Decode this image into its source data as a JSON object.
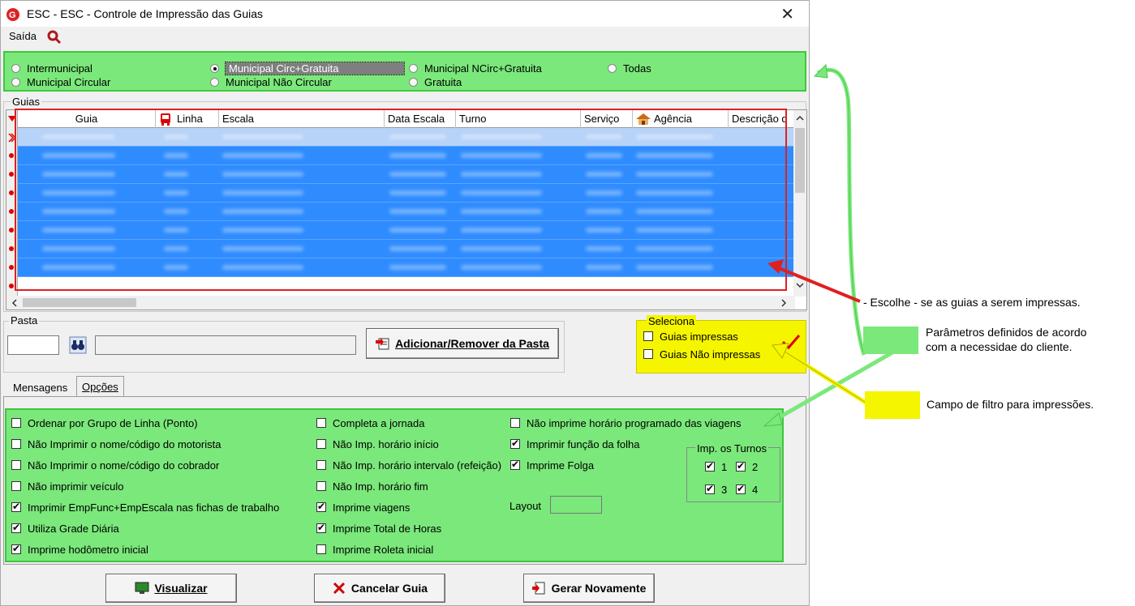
{
  "window": {
    "title": "ESC -  ESC - Controle de Impressão das Guias",
    "close_glyph": "✕"
  },
  "menu": {
    "saida": "Saída"
  },
  "tipo_guia": {
    "options": [
      {
        "label": "Intermunicipal",
        "checked": false
      },
      {
        "label": "Municipal Circular",
        "checked": false
      },
      {
        "label": "Municipal Circ+Gratuita",
        "checked": true
      },
      {
        "label": "Municipal Não Circular",
        "checked": false
      },
      {
        "label": "Municipal NCirc+Gratuita",
        "checked": false
      },
      {
        "label": "Gratuita",
        "checked": false
      },
      {
        "label": "Todas",
        "checked": false
      }
    ]
  },
  "guias": {
    "group_label": "Guias",
    "columns": [
      "Guia",
      "Linha",
      "Escala",
      "Data Escala",
      "Turno",
      "Serviço",
      "Agência",
      "Descrição d"
    ],
    "row_count": 9
  },
  "pasta": {
    "group_label": "Pasta",
    "code_value": "",
    "name_value": "",
    "add_remove_button": "Adicionar/Remover da Pasta"
  },
  "seleciona": {
    "group_label": "Seleciona",
    "guias_impressas": {
      "label": "Guias impressas",
      "checked": false
    },
    "guias_nao_impressas": {
      "label": "Guias Não impressas",
      "checked": false
    }
  },
  "tabs": {
    "mensagens": "Mensagens",
    "opcoes": "Opções"
  },
  "opcoes": {
    "col1": [
      {
        "label": "Ordenar por Grupo de Linha (Ponto)",
        "checked": false
      },
      {
        "label": "Não Imprimir o nome/código do motorista",
        "checked": false
      },
      {
        "label": "Não Imprimir o nome/código do cobrador",
        "checked": false
      },
      {
        "label": "Não imprimir veículo",
        "checked": false
      },
      {
        "label": "Imprimir EmpFunc+EmpEscala nas fichas de trabalho",
        "checked": true
      },
      {
        "label": "Utiliza Grade Diária",
        "checked": true
      },
      {
        "label": "Imprime hodômetro inicial",
        "checked": true
      }
    ],
    "col2": [
      {
        "label": "Completa a jornada",
        "checked": false
      },
      {
        "label": "Não Imp. horário início",
        "checked": false
      },
      {
        "label": "Não Imp. horário intervalo (refeição)",
        "checked": false
      },
      {
        "label": "Não Imp. horário fim",
        "checked": false
      },
      {
        "label": "Imprime viagens",
        "checked": true
      },
      {
        "label": "Imprime Total de Horas",
        "checked": true
      },
      {
        "label": "Imprime Roleta inicial",
        "checked": false
      }
    ],
    "col3": [
      {
        "label": "Não imprime horário programado das viagens",
        "checked": false
      },
      {
        "label": "Imprimir função da folha",
        "checked": true
      },
      {
        "label": "Imprime Folga",
        "checked": true
      }
    ],
    "layout_label": "Layout",
    "layout_value": "",
    "turnos_label": "Imp. os Turnos",
    "turnos": [
      {
        "label": "1",
        "checked": true
      },
      {
        "label": "2",
        "checked": true
      },
      {
        "label": "3",
        "checked": true
      },
      {
        "label": "4",
        "checked": true
      }
    ]
  },
  "buttons": {
    "visualizar": "Visualizar",
    "cancelar": "Cancelar Guia",
    "gerar": "Gerar Novamente"
  },
  "annotations": {
    "escolhe": "- Escolhe - se as guias a serem impressas.",
    "parametros_line1": "Parâmetros definidos de acordo",
    "parametros_line2": "com a necessidae do cliente.",
    "campo_filtro": "Campo de filtro para impressões.",
    "green_color": "#7be87b",
    "yellow_color": "#f5f500",
    "red_color": "#e02020"
  }
}
